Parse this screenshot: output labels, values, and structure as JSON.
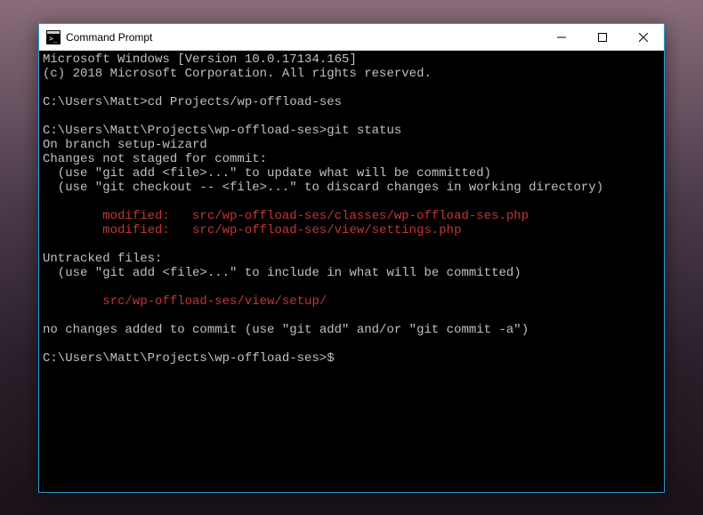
{
  "window": {
    "title": "Command Prompt"
  },
  "terminal": {
    "line0": "Microsoft Windows [Version 10.0.17134.165]",
    "line1": "(c) 2018 Microsoft Corporation. All rights reserved.",
    "blank0": "",
    "prompt0": "C:\\Users\\Matt>",
    "cmd0": "cd Projects/wp-offload-ses",
    "blank1": "",
    "prompt1": "C:\\Users\\Matt\\Projects\\wp-offload-ses>",
    "cmd1": "git status",
    "line2": "On branch setup-wizard",
    "line3": "Changes not staged for commit:",
    "line4": "  (use \"git add <file>...\" to update what will be committed)",
    "line5": "  (use \"git checkout -- <file>...\" to discard changes in working directory)",
    "blank2": "",
    "mod0": "        modified:   src/wp-offload-ses/classes/wp-offload-ses.php",
    "mod1": "        modified:   src/wp-offload-ses/view/settings.php",
    "blank3": "",
    "line6": "Untracked files:",
    "line7": "  (use \"git add <file>...\" to include in what will be committed)",
    "blank4": "",
    "untracked0": "        src/wp-offload-ses/view/setup/",
    "blank5": "",
    "line8": "no changes added to commit (use \"git add\" and/or \"git commit -a\")",
    "blank6": "",
    "prompt2": "C:\\Users\\Matt\\Projects\\wp-offload-ses>",
    "cursor": "$"
  }
}
